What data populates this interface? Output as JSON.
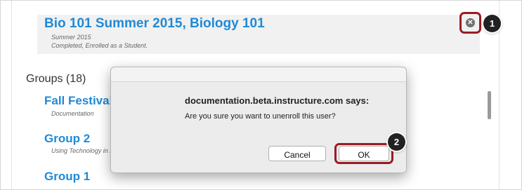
{
  "course": {
    "title": "Bio 101 Summer 2015, Biology 101",
    "term": "Summer 2015",
    "status": "Completed, Enrolled as a Student."
  },
  "unenroll_icon": "close-circle-icon",
  "callouts": [
    "1",
    "2"
  ],
  "groups": {
    "heading": "Groups (18)",
    "items": [
      {
        "name": "Fall Festival",
        "sub": "Documentation"
      },
      {
        "name": "Group 2",
        "sub": "Using Technology in E"
      },
      {
        "name": "Group 1",
        "sub": ""
      }
    ]
  },
  "dialog": {
    "source": "documentation.beta.instructure.com says:",
    "message": "Are you sure you want to unenroll this user?",
    "cancel_label": "Cancel",
    "ok_label": "OK"
  },
  "colors": {
    "link": "#1f8ad6",
    "highlight": "#9b1b22",
    "callout": "#222222"
  }
}
